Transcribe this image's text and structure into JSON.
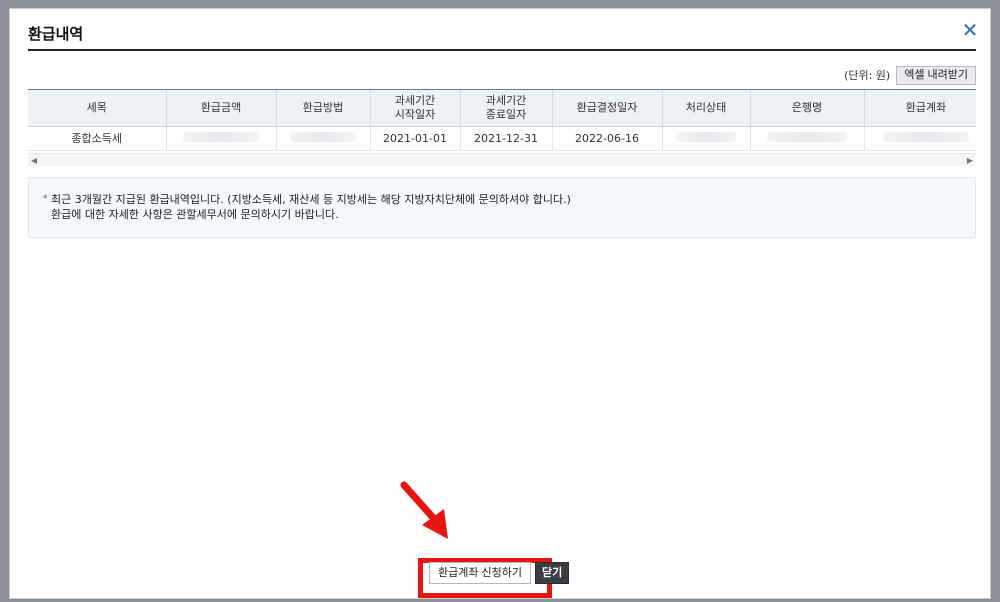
{
  "dialog": {
    "title": "환급내역",
    "close_icon": "close-icon"
  },
  "toolbar": {
    "unit_label": "(단위: 원)",
    "excel_button": "엑셀 내려받기"
  },
  "table": {
    "headers": [
      [
        "세목"
      ],
      [
        "환급금액"
      ],
      [
        "환급방법"
      ],
      [
        "과세기간",
        "시작일자"
      ],
      [
        "과세기간",
        "종료일자"
      ],
      [
        "환급결정일자"
      ],
      [
        "처리상태"
      ],
      [
        "은행명"
      ],
      [
        "환급계좌"
      ]
    ],
    "rows": [
      {
        "tax_item": "종합소득세",
        "refund_amount": "",
        "refund_method": "",
        "period_start": "2021-01-01",
        "period_end": "2021-12-31",
        "decision_date": "2022-06-16",
        "status": "",
        "bank": "",
        "account": ""
      }
    ]
  },
  "notice": {
    "lines": [
      "최근 3개월간 지급된 환급내역입니다. (지방소득세, 재산세 등 지방세는 해당 지방자치단체에 문의하셔야 합니다.)",
      "환급에 대한 자세한 사항은 관할세무서에 문의하시기 바랍니다."
    ]
  },
  "buttons": {
    "apply": "환급계좌 신청하기",
    "close": "닫기"
  },
  "colors": {
    "highlight": "#e8140f",
    "accent": "#2a6db8"
  }
}
